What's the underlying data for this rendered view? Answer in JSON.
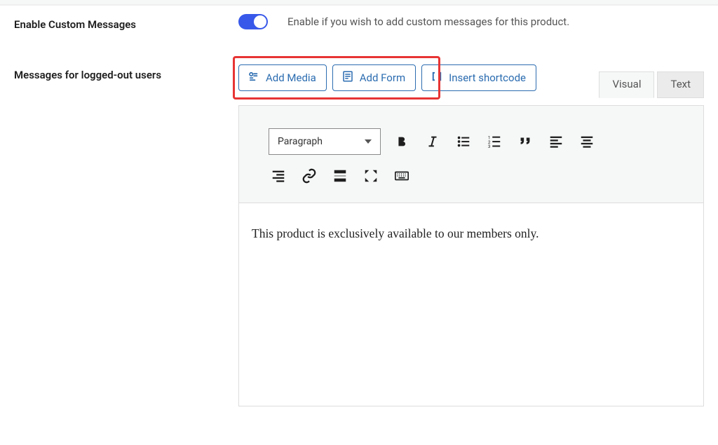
{
  "enable": {
    "label": "Enable Custom Messages",
    "description": "Enable if you wish to add custom messages for this product."
  },
  "messages": {
    "label": "Messages for logged-out users"
  },
  "buttons": {
    "add_media": "Add Media",
    "add_form": "Add Form",
    "insert_shortcode": "Insert shortcode"
  },
  "tabs": {
    "visual": "Visual",
    "text": "Text"
  },
  "toolbar": {
    "format_select": "Paragraph"
  },
  "editor": {
    "content": "This product is exclusively available to our members only."
  }
}
